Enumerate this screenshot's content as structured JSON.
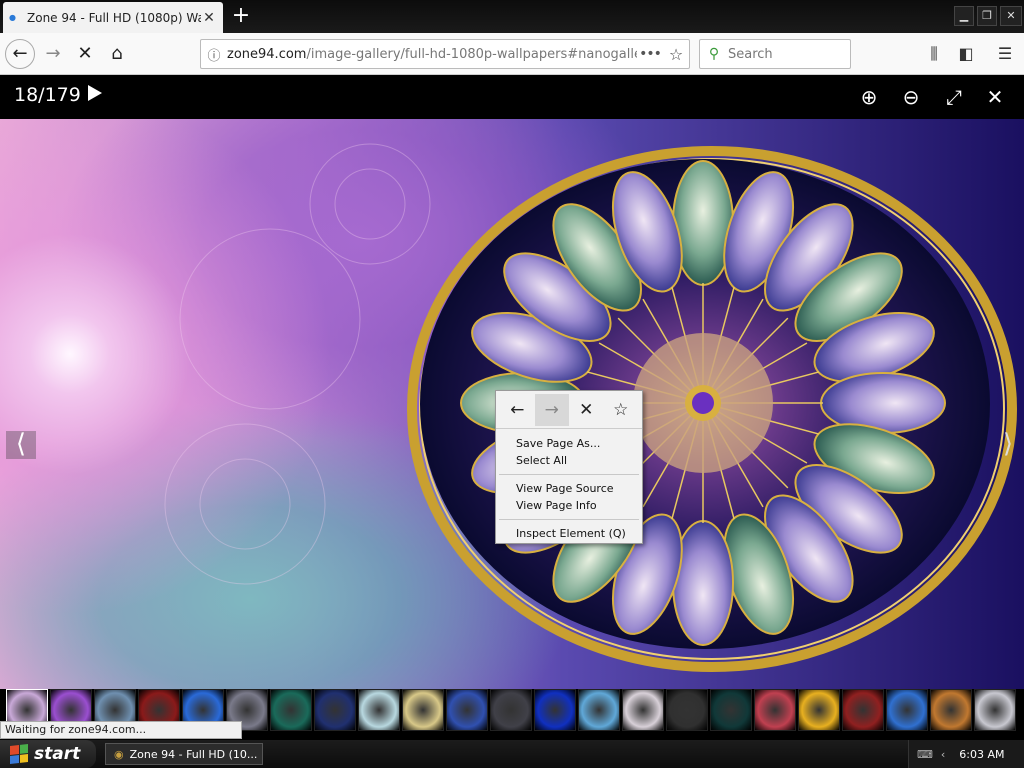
{
  "browser": {
    "tab_title": "Zone 94 - Full HD (1080p) Wallpap",
    "url_host": "zone94.com",
    "url_path": "/image-gallery/full-hd-1080p-wallpapers#nanogaller",
    "search_placeholder": "Search"
  },
  "viewer": {
    "counter": "18/179",
    "prev_glyph": "⟨",
    "next_glyph": "⟩"
  },
  "context_menu": {
    "items": [
      {
        "label": "Save Page As..."
      },
      {
        "label": "Select All"
      },
      {
        "label": "View Page Source"
      },
      {
        "label": "View Page Info"
      },
      {
        "label": "Inspect Element (Q)"
      }
    ]
  },
  "status_text": "Waiting for zone94.com...",
  "taskbar": {
    "start_label": "start",
    "task_label": "Zone 94 - Full HD (10...",
    "clock": "6:03 AM"
  },
  "thumbnail_colors": [
    "#c9a9d8",
    "#9a4fd0",
    "#6f90b0",
    "#8a1a1a",
    "#2a6ad8",
    "#7a7a8a",
    "#1a6a5a",
    "#203070",
    "#b8d8e0",
    "#d8c888",
    "#3050b0",
    "#404048",
    "#1030c0",
    "#60a8d8",
    "#d8d0d8",
    "#303030",
    "#103838",
    "#c04050",
    "#e8b020",
    "#902020",
    "#3070d0",
    "#c07830",
    "#c8c8d0"
  ]
}
